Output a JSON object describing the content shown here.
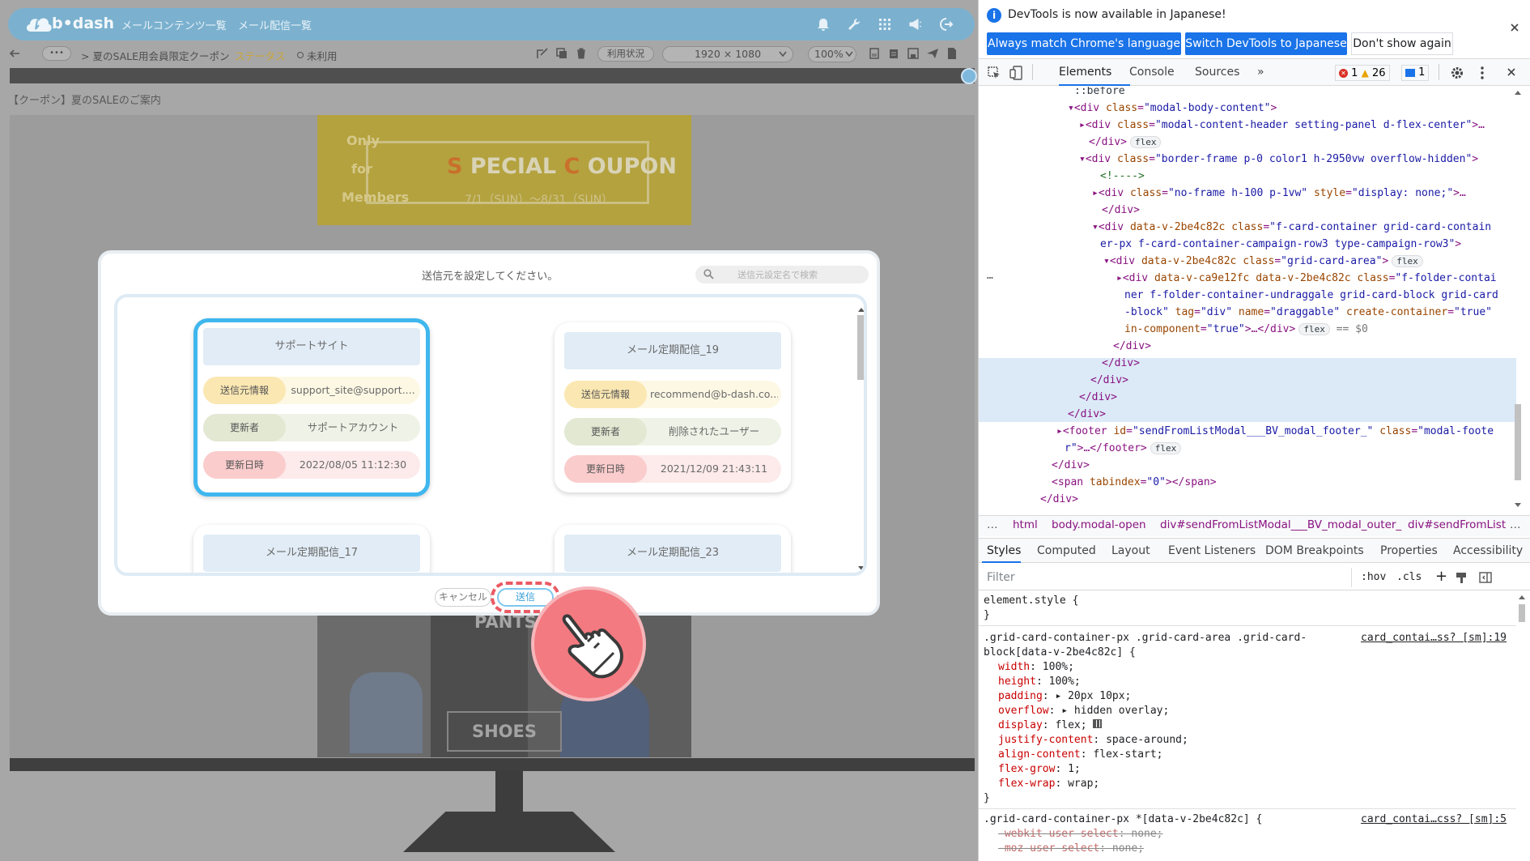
{
  "app": {
    "logo_text": "b•dash",
    "nav": [
      "メールコンテンツ一覧",
      "メール配信一覧"
    ],
    "toolbar": {
      "more": "•••",
      "breadcrumb": "> 夏のSALE用会員限定クーポン",
      "status_label": "ステータス",
      "status_value": "未利用",
      "usage_button": "利用状況",
      "resolution": "1920 × 1080",
      "zoom": "100%"
    },
    "sub_title": "【クーポン】夏のSALEのご案内",
    "coupon": {
      "only": "Only",
      "for": "for",
      "members": "Members",
      "special_s": "S",
      "special_rest": "PECIAL",
      "coupon_c": "C",
      "coupon_rest": "OUPON",
      "period": "7/1（SUN）～8/31（SUN）"
    },
    "banners": {
      "pants": "PANTS",
      "shoes": "SHOES"
    }
  },
  "modal": {
    "title": "送信元を設定してください。",
    "search_placeholder": "送信元設定名で検索",
    "labels": {
      "sender": "送信元情報",
      "updater": "更新者",
      "updated_at": "更新日時"
    },
    "cards": [
      {
        "name": "サポートサイト",
        "sender": "support_site@support....",
        "updater": "サポートアカウント",
        "updated_at": "2022/08/05 11:12:30",
        "selected": true
      },
      {
        "name": "メール定期配信_19",
        "sender": "recommend@b-dash.co....",
        "updater": "削除されたユーザー",
        "updated_at": "2021/12/09 21:43:11",
        "selected": false
      },
      {
        "name": "メール定期配信_17",
        "selected": false
      },
      {
        "name": "メール定期配信_23",
        "selected": false
      }
    ],
    "cancel": "キャンセル",
    "send": "送信"
  },
  "devtools": {
    "infobar": {
      "message": "DevTools is now available in Japanese!",
      "btn_match": "Always match Chrome's language",
      "btn_switch": "Switch DevTools to Japanese",
      "btn_dont_show": "Don't show again"
    },
    "tabs": [
      "Elements",
      "Console",
      "Sources"
    ],
    "more_tabs": "»",
    "errors": "1",
    "warnings": "26",
    "messages": "1",
    "dom_lines": {
      "l0": "::before",
      "l1_tag": "<div",
      "l1_attr": "class",
      "l1_val": "\"modal-body-content\"",
      "l1_end": ">",
      "l2_tag": "<div",
      "l2_attr": "class",
      "l2_val": "\"modal-content-header setting-panel d-flex-center\"",
      "l2_end": ">…",
      "l3": "</div>",
      "l4_tag": "<div",
      "l4_attr": "class",
      "l4_val": "\"border-frame p-0 color1 h-2950vw overflow-hidden\"",
      "l4_end": ">",
      "l5": "<!---->",
      "l6_tag": "<div",
      "l6_attr": "class",
      "l6_val": "\"no-frame h-100 p-1vw\"",
      "l6_attr2": "style",
      "l6_val2": "\"display: none;\"",
      "l6_end": ">…",
      "l7": "</div>",
      "l8_tag": "<div",
      "l8_attr": "data-v-2be4c82c class",
      "l8_val": "\"f-card-container grid-card-contain",
      "l8b_val": "er-px f-card-container-campaign-row3 type-campaign-row3\"",
      "l8b_end": ">",
      "l9_tag": "<div",
      "l9_attr": "data-v-2be4c82c class",
      "l9_val": "\"grid-card-area\"",
      "l9_end": ">",
      "l10_tag": "<div",
      "l10_attr": "data-v-ca9e12fc data-v-2be4c82c class",
      "l10_val": "\"f-folder-contai",
      "l10b_val": "ner f-folder-container-undraggale grid-card-block grid-card",
      "l10c_val": "-block\"",
      "l10c_attr": "tag",
      "l10c_v1": "\"div\"",
      "l10c_attr2": "name",
      "l10c_v2": "\"draggable\"",
      "l10c_attr3": "create-container",
      "l10c_v3": "\"true\"",
      "l10d_attr": "in-component",
      "l10d_val": "\"true\"",
      "l10d_end": ">…</div>",
      "l10d_eq": "== $0",
      "close_div": "</div>",
      "footer_tag": "<footer",
      "footer_attr": "id",
      "footer_val": "\"sendFromListModal___BV_modal_footer_\"",
      "footer_attr2": "class",
      "footer_val2": "\"modal-foote",
      "footer2_val": "r\"",
      "footer2_end": ">…</footer>",
      "span_tag": "<span",
      "span_attr": "tabindex",
      "span_val": "\"0\"",
      "span_end": "></span>",
      "flex": "flex",
      "ellipsis": "…"
    },
    "breadcrumbs": [
      "…",
      "html",
      "body.modal-open",
      "div#sendFromListModal___BV_modal_outer_",
      "div#sendFromList"
    ],
    "subtabs": [
      "Styles",
      "Computed",
      "Layout",
      "Event Listeners",
      "DOM Breakpoints",
      "Properties",
      "Accessibility"
    ],
    "filter_placeholder": "Filter",
    "filter_tools": {
      "hov": ":hov",
      "cls": ".cls",
      "plus": "+"
    },
    "styles": {
      "element_style": "element.style {",
      "close": "}",
      "rule1_sel1": ".grid-card-container-px .grid-card-area .grid-card-",
      "rule1_sel2": "block[data-v-2be4c82c] {",
      "rule1_src": "card_contai…ss? [sm]:19",
      "props": [
        {
          "name": "width",
          "value": "100%;"
        },
        {
          "name": "height",
          "value": "100%;"
        },
        {
          "name": "padding",
          "value": "▸ 20px 10px;"
        },
        {
          "name": "overflow",
          "value": "▸ hidden overlay;"
        },
        {
          "name": "display",
          "value": "flex;"
        },
        {
          "name": "justify-content",
          "value": "space-around;"
        },
        {
          "name": "align-content",
          "value": "flex-start;"
        },
        {
          "name": "flex-grow",
          "value": "1;"
        },
        {
          "name": "flex-wrap",
          "value": "wrap;"
        }
      ],
      "rule2_sel": ".grid-card-container-px *[data-v-2be4c82c] {",
      "rule2_src": "card_contai…css? [sm]:5",
      "rule2_props": [
        {
          "name": "-webkit-user-select",
          "value": "none;"
        },
        {
          "name": "-moz-user-select",
          "value": "none;"
        }
      ]
    }
  },
  "colors": {
    "topbar": "#7bb1cf",
    "selected_card": "#3fb7ee",
    "send_highlight": "#ea5a64",
    "devtools_blue": "#1a73e8"
  }
}
